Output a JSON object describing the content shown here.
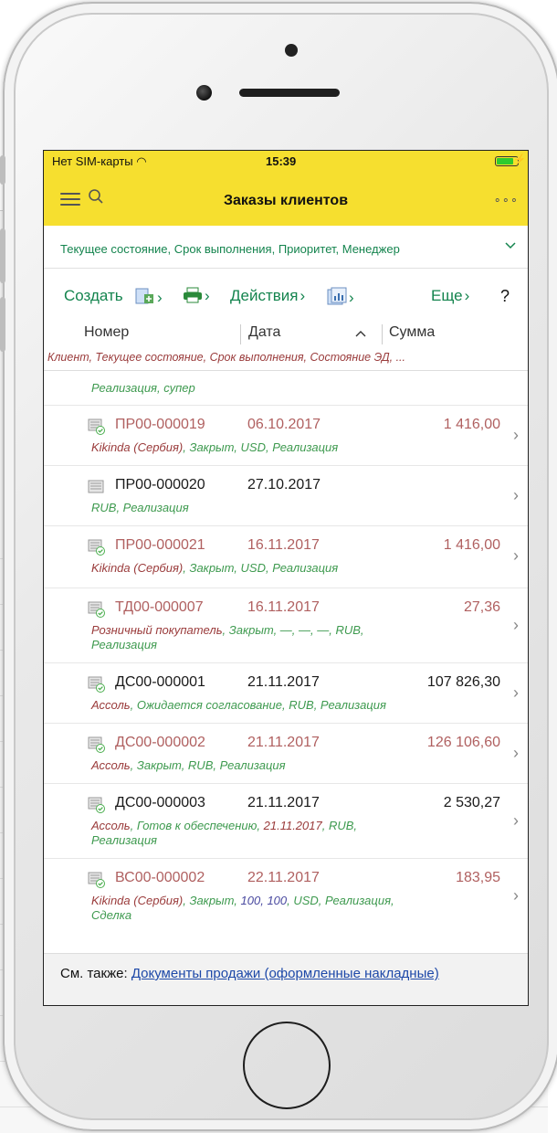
{
  "status_bar": {
    "carrier": "Нет SIM-карты",
    "time": "15:39"
  },
  "header": {
    "title": "Заказы клиентов",
    "more": "∘∘∘"
  },
  "filter": {
    "text": "Текущее состояние, Срок выполнения, Приоритет, Менеджер"
  },
  "commands": {
    "create": "Создать",
    "actions": "Действия",
    "more": "Еще",
    "help": "?"
  },
  "columns": {
    "number": "Номер",
    "date": "Дата",
    "sum": "Сумма",
    "sub": "Клиент, Текущее состояние, Срок выполнения, Состояние ЭД, ..."
  },
  "partial_row": "Реализация, супер",
  "rows": [
    {
      "number": "ПР00-000019",
      "date": "06.10.2017",
      "sum": "1 416,00",
      "d1": "Kikinda (Сербия)",
      "d2": ", Закрыт, USD, Реализация",
      "d3": ""
    },
    {
      "number": "ПР00-000020",
      "date": "27.10.2017",
      "sum": "",
      "d1": "",
      "d2": "RUB, Реализация",
      "d3": ""
    },
    {
      "number": "ПР00-000021",
      "date": "16.11.2017",
      "sum": "1 416,00",
      "d1": "Kikinda (Сербия)",
      "d2": ", Закрыт, USD, Реализация",
      "d3": ""
    },
    {
      "number": "ТД00-000007",
      "date": "16.11.2017",
      "sum": "27,36",
      "d1": "Розничный покупатель",
      "d2": ", Закрыт, —, —, —, RUB,",
      "d3": "Реализация"
    },
    {
      "number": "ДС00-000001",
      "date": "21.11.2017",
      "sum": "107 826,30",
      "d1": "Ассоль",
      "d2": ", Ожидается согласование, RUB, Реализация",
      "d3": ""
    },
    {
      "number": "ДС00-000002",
      "date": "21.11.2017",
      "sum": "126 106,60",
      "d1": "Ассоль",
      "d2": ", Закрыт, RUB, Реализация",
      "d3": ""
    },
    {
      "number": "ДС00-000003",
      "date": "21.11.2017",
      "sum": "2 530,27",
      "d1": "Ассоль",
      "d2a": ", Готов к обеспечению, ",
      "d2b": "21.11.2017",
      "d2c": ", RUB,",
      "d3": "Реализация"
    },
    {
      "number": "ВС00-000002",
      "date": "22.11.2017",
      "sum": "183,95",
      "d1": "Kikinda (Сербия)",
      "d2a": ", Закрыт, ",
      "d2b": "100, 100",
      "d2c": ", USD, Реализация,",
      "d3": "Сделка"
    }
  ],
  "see_also": {
    "label": "См. также: ",
    "link": "Документы продажи (оформленные накладные)"
  },
  "colors": {
    "header": "#f6df2f",
    "accent_green": "#14844e",
    "closed_red": "#b06060",
    "link_blue": "#1d48a8"
  }
}
